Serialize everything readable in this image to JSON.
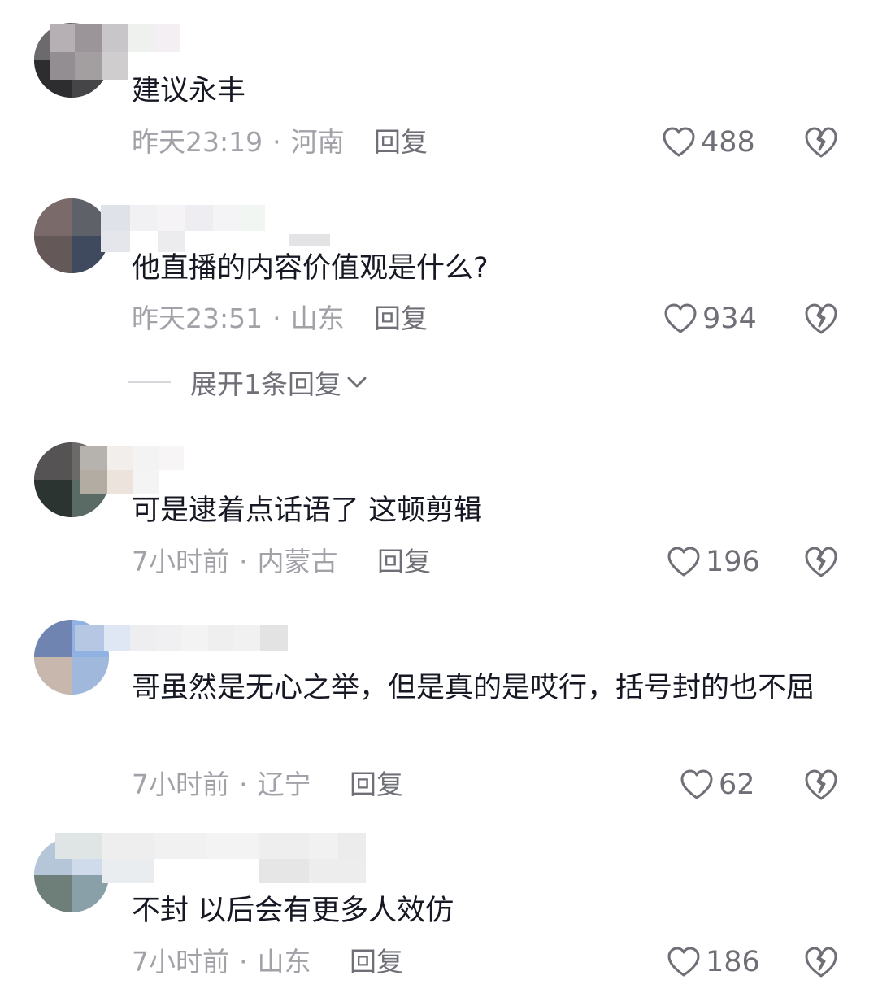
{
  "comments": [
    {
      "text": "建议永丰",
      "time": "昨天23:19",
      "location": "河南",
      "reply_label": "回复",
      "likes": "488"
    },
    {
      "text": "他直播的内容价值观是什么?",
      "time": "昨天23:51",
      "location": "山东",
      "reply_label": "回复",
      "likes": "934",
      "expand_label": "展开1条回复"
    },
    {
      "text": "可是逮着点话语了 这顿剪辑",
      "time": "7小时前",
      "location": "内蒙古",
      "reply_label": "回复",
      "likes": "196"
    },
    {
      "text": "哥虽然是无心之举，但是真的是哎行，括号封的也不屈",
      "time": "7小时前",
      "location": "辽宁",
      "reply_label": "回复",
      "likes": "62"
    },
    {
      "text": "不封 以后会有更多人效仿",
      "time": "7小时前",
      "location": "山东",
      "reply_label": "回复",
      "likes": "186"
    }
  ],
  "separator": "·",
  "colors": {
    "text": "#161823",
    "meta": "#a1a1a8",
    "action": "#6f7077"
  },
  "icons": {
    "like": "heart-outline-icon",
    "dislike": "broken-heart-icon",
    "expand": "chevron-down-icon"
  }
}
